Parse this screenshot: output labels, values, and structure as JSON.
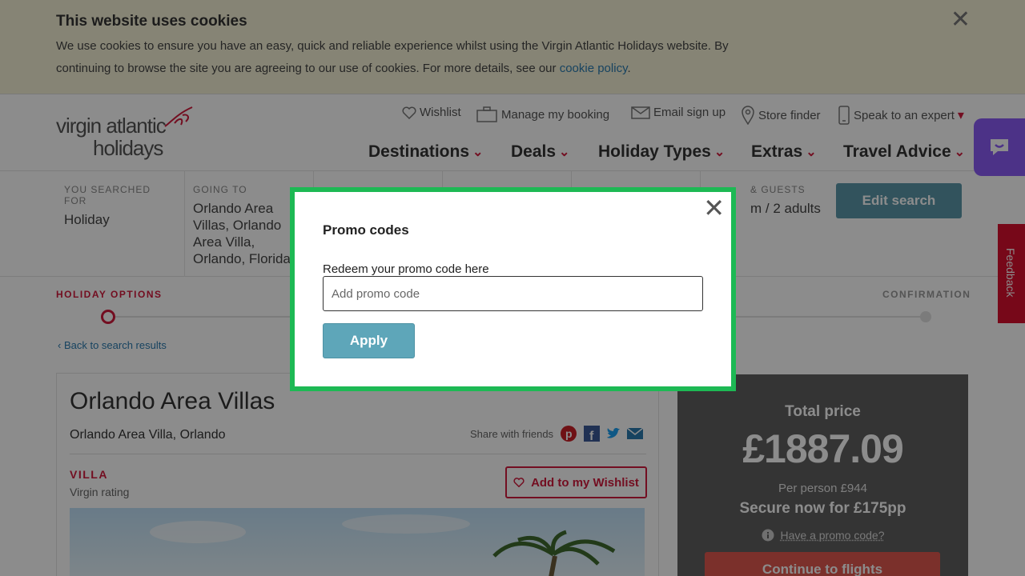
{
  "cookie": {
    "title": "This website uses cookies",
    "text": "We use cookies to ensure you have an easy, quick and reliable experience whilst using the Virgin Atlantic Holidays website. By continuing to browse the site you are agreeing to our use of cookies. For more details, see our",
    "link": "cookie policy",
    "period": "."
  },
  "header": {
    "logo_line1": "virgin atlantic",
    "logo_line2": "holidays",
    "utility": [
      "Wishlist",
      "Manage my booking",
      "Email sign up",
      "Store finder",
      "Speak to an expert"
    ],
    "nav": [
      "Destinations",
      "Deals",
      "Holiday Types",
      "Extras",
      "Travel Advice"
    ]
  },
  "feedback_label": "Feedback",
  "summary": {
    "searched_label": "YOU SEARCHED FOR",
    "searched_value": "Holiday",
    "going_label": "GOING TO",
    "going_value": "Orlando Area Villas, Orlando Area Villa, Orlando, Florida",
    "guests_label_visible": "& GUESTS",
    "guests_value_visible": "m / 2 adults",
    "edit_button": "Edit search"
  },
  "progress": {
    "current_step": "HOLIDAY OPTIONS",
    "last_step": "CONFIRMATION",
    "back_link": "Back to search results"
  },
  "product": {
    "title": "Orlando Area Villas",
    "location": "Orlando Area Villa, Orlando",
    "share_label": "Share with friends",
    "type": "VILLA",
    "rating_label": "Virgin rating",
    "wishlist_button": "Add to my Wishlist"
  },
  "price": {
    "total_label": "Total price",
    "total": "£1887.09",
    "per_person": "Per person £944",
    "secure": "Secure now for £175pp",
    "promo_link": "Have a promo code?",
    "continue_button": "Continue to flights"
  },
  "modal": {
    "title": "Promo codes",
    "field_label": "Redeem your promo code here",
    "placeholder": "Add promo code",
    "value": "",
    "apply_button": "Apply"
  },
  "colors": {
    "brand_red": "#d21b3c",
    "modal_border": "#1db954",
    "apply_button": "#5ea6b9",
    "chat": "#8a5cf6"
  }
}
